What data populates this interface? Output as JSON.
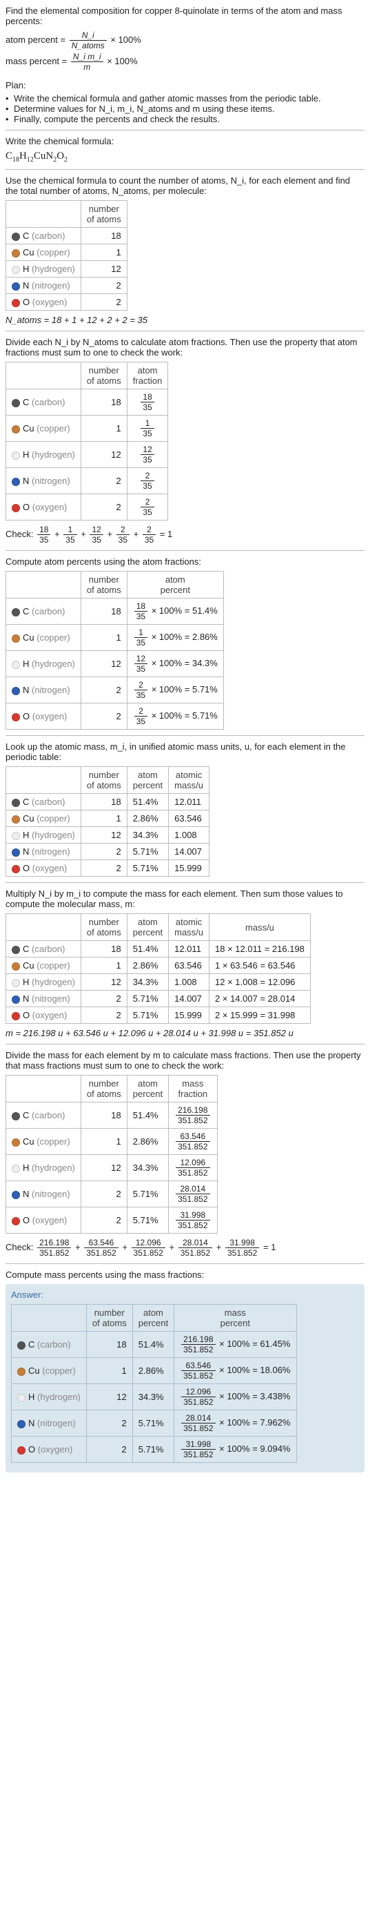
{
  "intro": "Find the elemental composition for copper 8-quinolate in terms of the atom and mass percents:",
  "atom_percent_label": "atom percent =",
  "atom_percent_frac_num": "N_i",
  "atom_percent_frac_den": "N_atoms",
  "times100": "× 100%",
  "mass_percent_label": "mass percent =",
  "mass_percent_frac_num": "N_i m_i",
  "mass_percent_frac_den": "m",
  "plan_label": "Plan:",
  "plan_items": [
    "Write the chemical formula and gather atomic masses from the periodic table.",
    "Determine values for N_i, m_i, N_atoms and m using these items.",
    "Finally, compute the percents and check the results."
  ],
  "write_formula_label": "Write the chemical formula:",
  "chem_formula_parts": [
    "C",
    "18",
    "H",
    "12",
    "CuN",
    "2",
    "O",
    "2"
  ],
  "count_atoms_text": "Use the chemical formula to count the number of atoms, N_i, for each element and find the total number of atoms, N_atoms, per molecule:",
  "elements": [
    {
      "color": "#555555",
      "sym": "C",
      "label": "(carbon)",
      "n": "18",
      "afrac_num": "18",
      "afrac_den": "35",
      "apct": "51.4%",
      "amass": "12.011",
      "masscalc": "18 × 12.011 = 216.198",
      "massu": "216.198",
      "mpct": "61.45%"
    },
    {
      "color": "#c77e3a",
      "sym": "Cu",
      "label": "(copper)",
      "n": "1",
      "afrac_num": "1",
      "afrac_den": "35",
      "apct": "2.86%",
      "amass": "63.546",
      "masscalc": "1 × 63.546 = 63.546",
      "massu": "63.546",
      "mpct": "18.06%"
    },
    {
      "color": "#eeeeee",
      "sym": "H",
      "label": "(hydrogen)",
      "n": "12",
      "afrac_num": "12",
      "afrac_den": "35",
      "apct": "34.3%",
      "amass": "1.008",
      "masscalc": "12 × 1.008 = 12.096",
      "massu": "12.096",
      "mpct": "3.438%"
    },
    {
      "color": "#2e5fb3",
      "sym": "N",
      "label": "(nitrogen)",
      "n": "2",
      "afrac_num": "2",
      "afrac_den": "35",
      "apct": "5.71%",
      "amass": "14.007",
      "masscalc": "2 × 14.007 = 28.014",
      "massu": "28.014",
      "mpct": "7.962%"
    },
    {
      "color": "#d63a2f",
      "sym": "O",
      "label": "(oxygen)",
      "n": "2",
      "afrac_num": "2",
      "afrac_den": "35",
      "apct": "5.71%",
      "amass": "15.999",
      "masscalc": "2 × 15.999 = 31.998",
      "massu": "31.998",
      "mpct": "9.094%"
    }
  ],
  "headers": {
    "num_atoms": "number\nof atoms",
    "atom_fraction": "atom\nfraction",
    "atom_percent": "atom\npercent",
    "atomic_mass": "atomic\nmass/u",
    "mass_u": "mass/u",
    "mass_fraction": "mass\nfraction",
    "mass_percent": "mass\npercent"
  },
  "natoms_line": "N_atoms = 18 + 1 + 12 + 2 + 2 = 35",
  "divide_text": "Divide each N_i by N_atoms to calculate atom fractions. Then use the property that atom fractions must sum to one to check the work:",
  "check_fracs": "= 1",
  "check_label": "Check:",
  "compute_atom_pct_text": "Compute atom percents using the atom fractions:",
  "lookup_mass_text": "Look up the atomic mass, m_i, in unified atomic mass units, u, for each element in the periodic table:",
  "multiply_text": "Multiply N_i by m_i to compute the mass for each element. Then sum those values to compute the molecular mass, m:",
  "m_line": "m = 216.198 u + 63.546 u + 12.096 u + 28.014 u + 31.998 u = 351.852 u",
  "divide_mass_text": "Divide the mass for each element by m to calculate mass fractions. Then use the property that mass fractions must sum to one to check the work:",
  "mass_den": "351.852",
  "compute_mass_pct_text": "Compute mass percents using the mass fractions:",
  "answer_label": "Answer:"
}
